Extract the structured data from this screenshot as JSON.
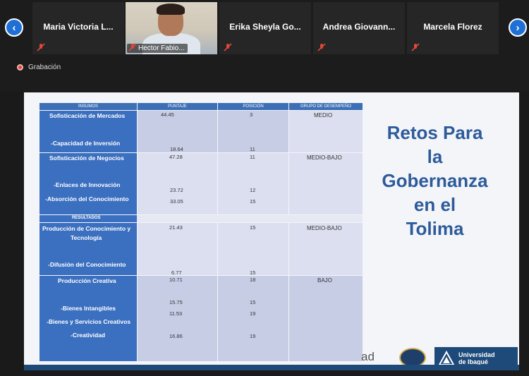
{
  "participants": [
    {
      "name": "Maria Victoria L...",
      "muted": true
    },
    {
      "name": "Hector Fabio...",
      "muted": true,
      "video": true
    },
    {
      "name": "Erika Sheyla Go...",
      "muted": true
    },
    {
      "name": "Andrea Giovann...",
      "muted": true
    },
    {
      "name": "Marcela Florez",
      "muted": true
    }
  ],
  "recording": {
    "label": "Grabación"
  },
  "colors": {
    "accent": "#1e6fd6",
    "table_header": "#3c6fb6",
    "title": "#2d5b9a",
    "record": "#e0463a"
  },
  "slide": {
    "title_lines": [
      "Retos Para",
      "la",
      "Gobernanza",
      "en el",
      "Tolima"
    ],
    "trailing_text": "ad",
    "logo": {
      "line1": "Universidad",
      "line2": "de Ibagué"
    },
    "table": {
      "headers": [
        "INSUMOS",
        "PUNTAJE",
        "POSICIÓN",
        "GRUPO DE DESEMPEÑO"
      ],
      "results_label": "RESULTADOS",
      "rows": [
        {
          "label": "Sofisticación de Mercados",
          "score": "44.45",
          "pos": "3",
          "group": "MEDIO"
        },
        {
          "label": "-Capacidad de Inversión",
          "score": "18.64",
          "pos": "11",
          "group": ""
        },
        {
          "label": "Sofisticación de Negocios",
          "score": "47.28",
          "pos": "11",
          "group": "MEDIO-BAJO"
        },
        {
          "label": "-Enlaces de Innovación",
          "score": "23.72",
          "pos": "12",
          "group": ""
        },
        {
          "label": "-Absorción del Conocimiento",
          "score": "33.05",
          "pos": "15",
          "group": ""
        },
        {
          "label": "Producción de Conocimiento y",
          "label2": "Tecnología",
          "score": "21.43",
          "pos": "15",
          "group": "MEDIO-BAJO"
        },
        {
          "label": "-Difusión del Conocimiento",
          "score": "6.77",
          "pos": "15",
          "group": ""
        },
        {
          "label": "Producción Creativa",
          "score": "10.71",
          "pos": "18",
          "group": "BAJO"
        },
        {
          "label": "-Bienes Intangibles",
          "score": "15.75",
          "pos": "15",
          "group": ""
        },
        {
          "label": "-Bienes y Servicios Creativos",
          "score": "11.53",
          "pos": "19",
          "group": ""
        },
        {
          "label": "-Creatividad",
          "score": "16.86",
          "pos": "19",
          "group": ""
        }
      ]
    }
  }
}
